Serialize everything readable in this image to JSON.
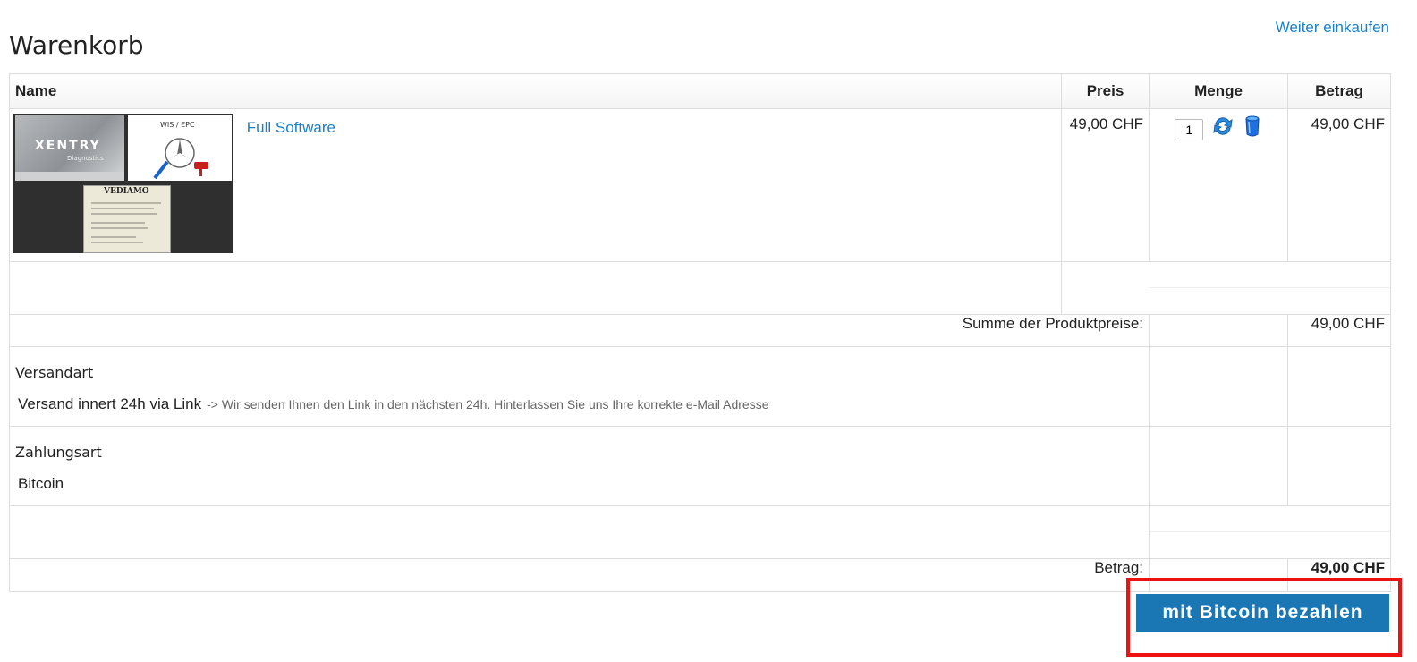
{
  "page": {
    "title": "Warenkorb",
    "continue_link": "Weiter einkaufen"
  },
  "table": {
    "columns": {
      "name": "Name",
      "price": "Preis",
      "quantity": "Menge",
      "amount": "Betrag"
    },
    "product": {
      "name": "Full Software",
      "price": "49,00 CHF",
      "quantity": "1",
      "amount": "49,00 CHF",
      "thumbnail_texts": {
        "xentry": "XENTRY",
        "diagnostics": "Diagnostics",
        "wis": "WIS / EPC",
        "vediamo": "VEDIAMO"
      }
    },
    "subtotal": {
      "label": "Summe der Produktpreise:",
      "value": "49,00 CHF"
    },
    "shipping": {
      "label": "Versandart",
      "method": "Versand innert 24h via Link",
      "note": "-> Wir senden Ihnen den Link in den nächsten 24h. Hinterlassen Sie uns Ihre korrekte e-Mail Adresse"
    },
    "payment": {
      "label": "Zahlungsart",
      "method": "Bitcoin"
    },
    "total": {
      "label": "Betrag:",
      "value": "49,00 CHF"
    }
  },
  "actions": {
    "pay_button": "mit Bitcoin bezahlen"
  },
  "icons": {
    "update": "refresh-icon",
    "delete": "trash-icon"
  },
  "colors": {
    "link": "#1a80c8",
    "button": "#1a77b4",
    "highlight": "#ee1111"
  }
}
